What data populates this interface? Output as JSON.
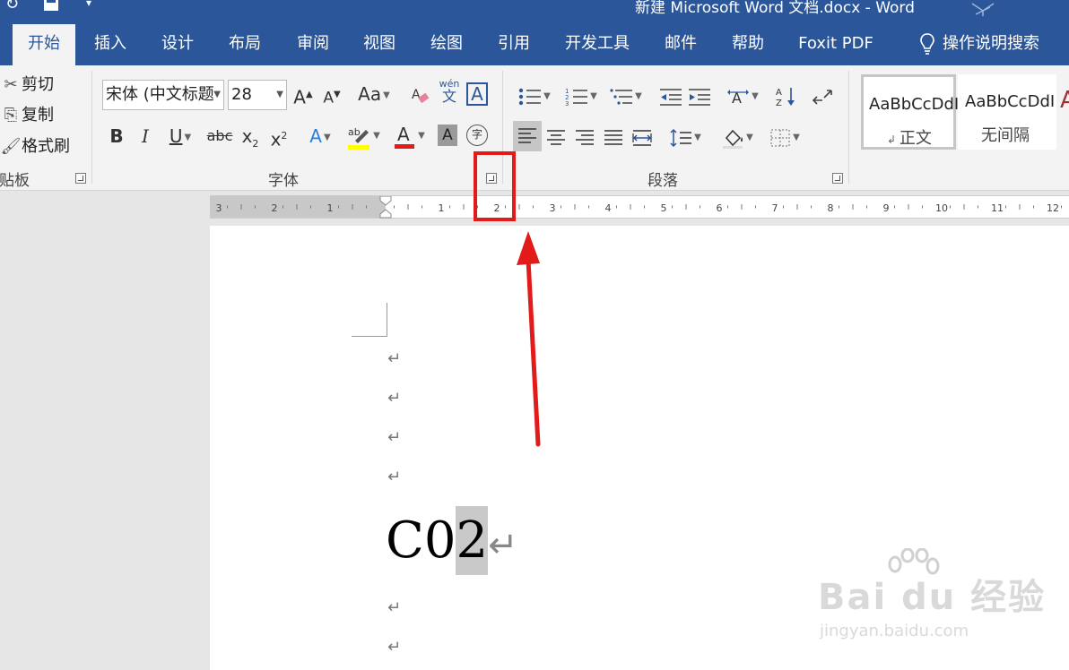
{
  "titlebar": {
    "title": "新建 Microsoft Word 文档.docx  -  Word"
  },
  "tabs": [
    {
      "label": "开始",
      "active": true
    },
    {
      "label": "插入"
    },
    {
      "label": "设计"
    },
    {
      "label": "布局"
    },
    {
      "label": "审阅"
    },
    {
      "label": "视图"
    },
    {
      "label": "绘图"
    },
    {
      "label": "引用"
    },
    {
      "label": "开发工具"
    },
    {
      "label": "邮件"
    },
    {
      "label": "帮助"
    },
    {
      "label": "Foxit PDF"
    },
    {
      "label": "操作说明搜索"
    }
  ],
  "clipboard": {
    "cut": "剪切",
    "copy": "复制",
    "format_painter": "格式刷",
    "group_label": "粘贴板"
  },
  "font": {
    "name": "宋体 (中文标题",
    "size": "28",
    "group_label": "字体",
    "change_case": "Aa",
    "bold": "B",
    "italic": "I",
    "underline": "U",
    "strikethrough": "abc",
    "subscript": "x",
    "superscript": "x",
    "phonetic_top": "wén",
    "phonetic_bottom": "文",
    "enclose_char": "字"
  },
  "paragraph": {
    "group_label": "段落"
  },
  "styles": [
    {
      "sample": "AaBbCcDdI",
      "name": "正文"
    },
    {
      "sample": "AaBbCcDdI",
      "name": "无间隔"
    }
  ],
  "ruler": {
    "left_labels": [
      "3",
      "2",
      "1"
    ],
    "right_labels": [
      "1",
      "2",
      "3",
      "4",
      "5",
      "6",
      "7",
      "8",
      "9",
      "10",
      "11",
      "12"
    ]
  },
  "document": {
    "text_before": "C0",
    "text_selected": "2",
    "return_mark": "↵"
  },
  "watermark": {
    "main": "Bai du 经验",
    "sub": "jingyan.baidu.com"
  },
  "colors": {
    "title_bar": "#2b579a",
    "annotation": "#e21a1a",
    "highlight_bar": "#ffff00",
    "font_color_bar": "#e21a1a"
  }
}
